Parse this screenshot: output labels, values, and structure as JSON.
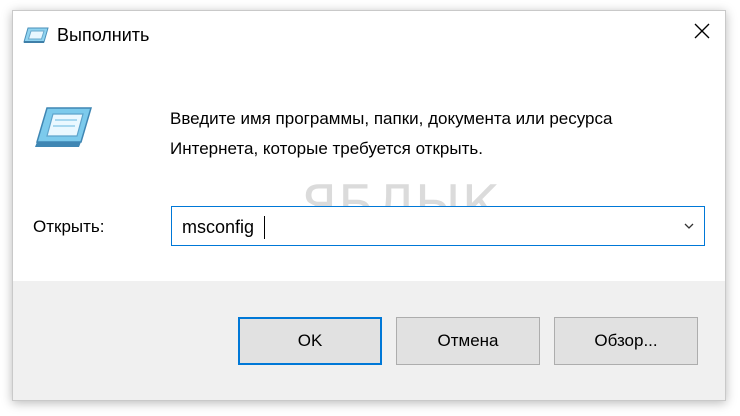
{
  "window": {
    "title": "Выполнить",
    "close_icon": "close-icon"
  },
  "icons": {
    "title": "run-icon",
    "dialog": "run-icon"
  },
  "description": {
    "line1": "Введите имя программы, папки, документа или ресурса",
    "line2": "Интернета, которые требуется открыть."
  },
  "watermark": "ЯБЛЫК",
  "open_field": {
    "label": "Открыть:",
    "value": "msconfig",
    "dropdown_icon": "chevron-down-icon"
  },
  "buttons": {
    "ok": "OK",
    "cancel": "Отмена",
    "browse": "Обзор..."
  },
  "colors": {
    "accent": "#0078d7",
    "footer_bg": "#f0f0f0",
    "button_bg": "#e1e1e1"
  }
}
